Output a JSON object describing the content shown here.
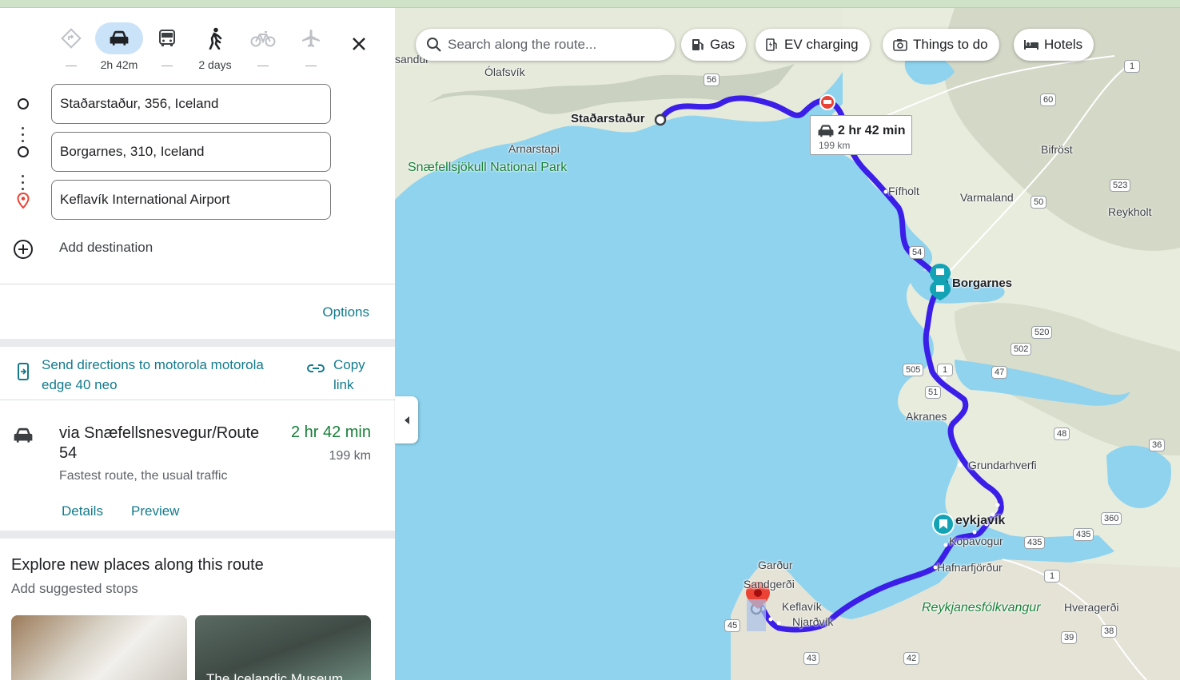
{
  "modes": [
    {
      "name": "best",
      "label": "",
      "icon": "diamond-route-icon",
      "dash": "—"
    },
    {
      "name": "driving",
      "label": "2h 42m",
      "icon": "car-icon",
      "active": true
    },
    {
      "name": "transit",
      "label": "",
      "icon": "bus-icon",
      "dash": "—"
    },
    {
      "name": "walking",
      "label": "2 days",
      "icon": "walk-icon"
    },
    {
      "name": "cycling",
      "label": "",
      "icon": "bike-icon",
      "dash": "—"
    },
    {
      "name": "flight",
      "label": "",
      "icon": "plane-icon",
      "dash": "—"
    }
  ],
  "stops": [
    {
      "value": "Staðarstaður, 356, Iceland"
    },
    {
      "value": "Borgarnes, 310, Iceland"
    },
    {
      "value": "Keflavík International Airport"
    }
  ],
  "add_destination": "Add destination",
  "options_label": "Options",
  "send_directions": {
    "text": "Send directions to motorola motorola edge 40 neo",
    "copy": "Copy link"
  },
  "route": {
    "via": "via Snæfellsnesvegur/Route 54",
    "duration": "2 hr 42 min",
    "distance": "199 km",
    "subtitle": "Fastest route, the usual traffic",
    "details": "Details",
    "preview": "Preview"
  },
  "explore": {
    "title": "Explore new places along this route",
    "subtitle": "Add suggested stops",
    "cards": [
      {
        "caption": ""
      },
      {
        "caption": "The Icelandic Museum"
      }
    ]
  },
  "map": {
    "search_placeholder": "Search along the route...",
    "chips": [
      {
        "label": "Gas",
        "icon": "gas-station-icon"
      },
      {
        "label": "EV charging",
        "icon": "ev-charging-icon"
      },
      {
        "label": "Things to do",
        "icon": "camera-icon"
      },
      {
        "label": "Hotels",
        "icon": "bed-icon"
      }
    ],
    "callout": {
      "duration": "2 hr 42 min",
      "distance": "199 km"
    },
    "labels": {
      "stadarstadur": "Staðarstaður",
      "borgarnes": "Borgarnes",
      "reykjavik": "eykjavík",
      "olafsvik": "Ólafsvík",
      "arnarstapi": "Arnarstapi",
      "park": "Snæfellsjökull National Park",
      "fifholt": "Fífholt",
      "bifrost": "Bifröst",
      "varmaland": "Varmaland",
      "reykholt": "Reykholt",
      "akranes": "Akranes",
      "grundarhverfi": "Grundarhverfi",
      "kopavogur": "Kopavogur",
      "hafnarfjordur": "Hafnarfjörður",
      "gardur": "Garður",
      "sandgerdi": "Sandgerði",
      "keflavik": "Keflavík",
      "njardvik": "Njarðvík",
      "reykjanes": "Reykjanesfólkvangur",
      "hveragerdi": "Hveragerði",
      "sandur": "sandur"
    },
    "shields": [
      "56",
      "1",
      "60",
      "523",
      "50",
      "54",
      "520",
      "502",
      "505",
      "1",
      "47",
      "51",
      "48",
      "36",
      "360",
      "435",
      "435",
      "1",
      "45",
      "43",
      "42",
      "39",
      "38"
    ]
  },
  "colors": {
    "route": "#3b1ee8",
    "water": "#8fd3ee",
    "land": "#e9ecdf",
    "accent": "#137a8c",
    "green_text": "#188038",
    "active_mode": "#cbe3f8"
  }
}
